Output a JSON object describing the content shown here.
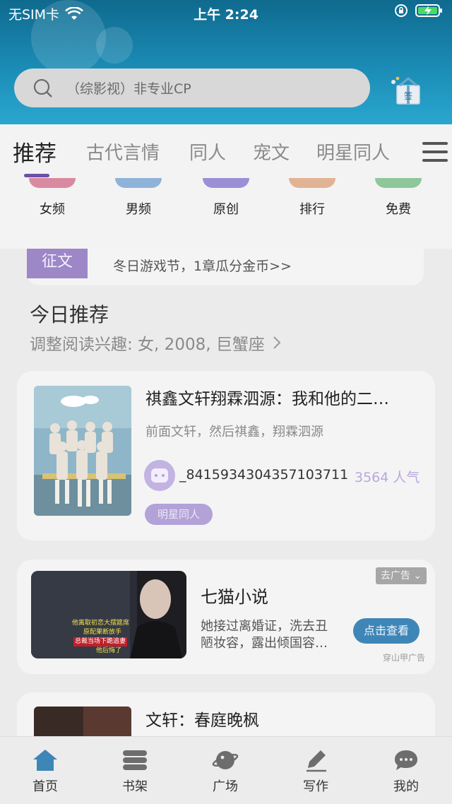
{
  "status_bar": {
    "carrier": "无SIM卡",
    "time": "上午 2:24"
  },
  "search": {
    "placeholder": "（综影视）非专业CP"
  },
  "gift": {
    "label": "签"
  },
  "tabs": [
    {
      "label": "推荐",
      "active": true
    },
    {
      "label": "古代言情"
    },
    {
      "label": "同人"
    },
    {
      "label": "宠文"
    },
    {
      "label": "明星同人"
    }
  ],
  "categories": [
    {
      "label": "女频",
      "color": "#d98aa0"
    },
    {
      "label": "男频",
      "color": "#8fb3d8"
    },
    {
      "label": "原创",
      "color": "#9b90d6"
    },
    {
      "label": "排行",
      "color": "#e1b394"
    },
    {
      "label": "免费",
      "color": "#8ec79a"
    }
  ],
  "notice": {
    "tag": "征文",
    "text": "冬日游戏节，1章瓜分金币>>"
  },
  "today": {
    "title": "今日推荐",
    "subtitle": "调整阅读兴趣: 女, 2008, 巨蟹座"
  },
  "book1": {
    "title": "祺鑫文轩翔霖泗源：我和他的二…",
    "desc": "前面文轩，然后祺鑫，翔霖泗源",
    "author": "_8415934304357103711",
    "popularity": "3564 人气",
    "tag": "明星同人"
  },
  "ad": {
    "badge": "去广告 ⌄",
    "title": "七猫小说",
    "desc_line1": "她接过离婚证，洗去丑",
    "desc_line2": "陋妆容，露出倾国容…",
    "button": "点击查看",
    "source": "穿山甲广告",
    "cover_lines": [
      "他离取初恋大摆筵席",
      "原配果断放手",
      "总裁当场下跪追妻",
      "他后悔了"
    ]
  },
  "book2": {
    "title": "文轩：春庭晚枫"
  },
  "tabbar": [
    {
      "label": "首页",
      "icon": "home-icon",
      "active": true
    },
    {
      "label": "书架",
      "icon": "bookshelf-icon"
    },
    {
      "label": "广场",
      "icon": "square-planet-icon"
    },
    {
      "label": "写作",
      "icon": "pen-icon"
    },
    {
      "label": "我的",
      "icon": "chat-bubble-icon"
    }
  ],
  "colors": {
    "header": "#1b8cb6",
    "accent": "#6b4fa8",
    "ad_button": "#3f86b8"
  }
}
